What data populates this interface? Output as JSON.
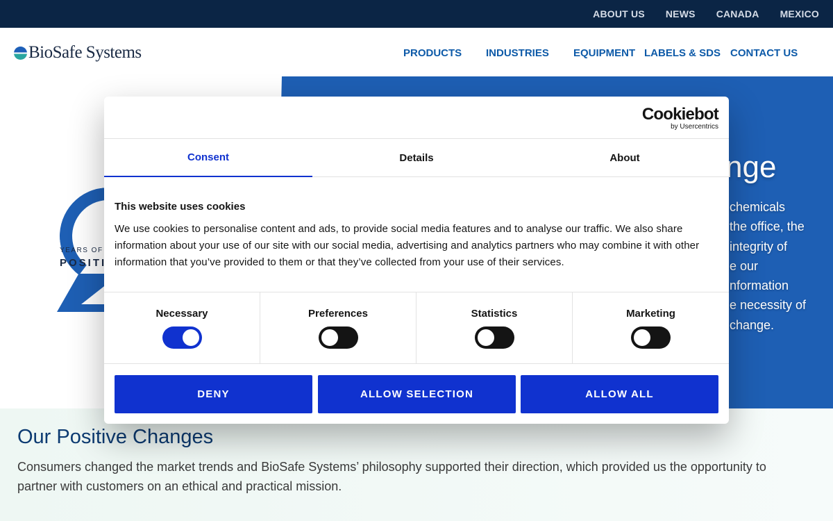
{
  "topbar": {
    "items": [
      "ABOUT US",
      "NEWS",
      "CANADA",
      "MEXICO"
    ]
  },
  "header": {
    "logo_text": "BioSafe Systems",
    "nav": [
      "PRODUCTS",
      "INDUSTRIES",
      "EQUIPMENT",
      "LABELS & SDS",
      "CONTACT US"
    ]
  },
  "hero": {
    "heading_partial": "nge",
    "paragraph_lines": [
      "chemicals",
      "the office, the",
      "integrity of",
      "e our",
      "nformation",
      "e necessity of",
      "change."
    ],
    "badge_line1": "YEARS OF",
    "badge_line2": "POSITI"
  },
  "section": {
    "heading": "Our Positive Changes",
    "paragraph": "Consumers changed the market trends and BioSafe Systems’ philosophy supported their direction, which provided us the opportunity to partner with customers on an ethical and practical mission."
  },
  "cookie": {
    "brand": "Cookiebot",
    "brand_sub": "by Usercentrics",
    "tabs": [
      "Consent",
      "Details",
      "About"
    ],
    "title": "This website uses cookies",
    "text": "We use cookies to personalise content and ads, to provide social media features and to analyse our traffic. We also share information about your use of our site with our social media, advertising and analytics partners who may combine it with other information that you’ve provided to them or that they’ve collected from your use of their services.",
    "categories": [
      {
        "label": "Necessary",
        "enabled": true
      },
      {
        "label": "Preferences",
        "enabled": false
      },
      {
        "label": "Statistics",
        "enabled": false
      },
      {
        "label": "Marketing",
        "enabled": false
      }
    ],
    "buttons": {
      "deny": "DENY",
      "allow_selection": "ALLOW SELECTION",
      "allow_all": "ALLOW ALL"
    },
    "colors": {
      "accent": "#1032cf",
      "toggle_off": "#141414"
    }
  }
}
